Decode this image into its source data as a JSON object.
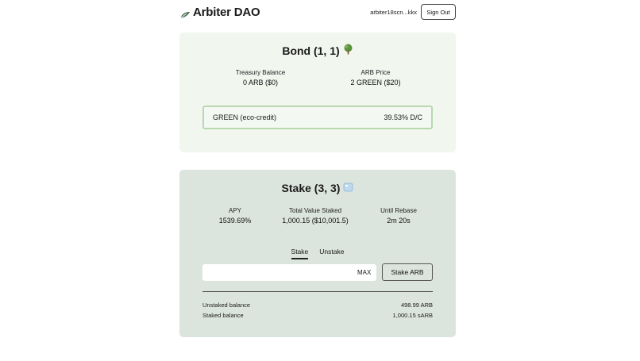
{
  "header": {
    "brand": "Arbiter DAO",
    "account": "arbiter18scn...kkx",
    "sign_out": "Sign Out"
  },
  "bond": {
    "title": "Bond (1, 1)",
    "title_icon": "tree-icon",
    "treasury_label": "Treasury Balance",
    "treasury_value": "0 ARB ($0)",
    "price_label": "ARB Price",
    "price_value": "2 GREEN ($20)",
    "item_name": "GREEN (eco-credit)",
    "item_rate": "39.53% D/C"
  },
  "stake": {
    "title": "Stake (3, 3)",
    "title_icon": "ice-cube-icon",
    "apy_label": "APY",
    "apy_value": "1539.69%",
    "tvs_label": "Total Value Staked",
    "tvs_value": "1,000.15 ($10,001.5)",
    "rebase_label": "Until Rebase",
    "rebase_value": "2m 20s",
    "tabs": [
      {
        "label": "Stake",
        "active": true
      },
      {
        "label": "Unstake",
        "active": false
      }
    ],
    "input_value": "",
    "max_label": "MAX",
    "button_label": "Stake ARB",
    "unstaked_label": "Unstaked balance",
    "unstaked_value": "498.99 ARB",
    "staked_label": "Staked balance",
    "staked_value": "1,000.15 sARB"
  },
  "colors": {
    "bond_card_bg": "#f1f6ef",
    "stake_card_bg": "#dce5dd",
    "green_border": "#b8d8b0"
  }
}
